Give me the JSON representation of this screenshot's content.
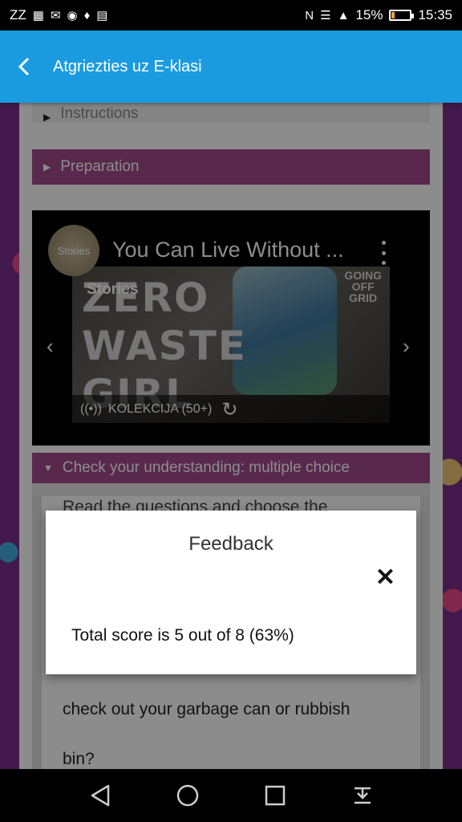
{
  "status_bar": {
    "left_text": "ZZ",
    "battery_percent": "15%",
    "time": "15:35",
    "battery_level": 0.15,
    "icons": [
      "sleep-icon",
      "image-icon",
      "mail-icon",
      "eye-icon",
      "bell-icon",
      "gift-icon",
      "nfc-icon",
      "wifi-icon",
      "signal-icon",
      "battery-icon"
    ]
  },
  "app_bar": {
    "title": "Atgriezties uz E-klasi",
    "background": "#1a9be0"
  },
  "sections": {
    "instructions": "Instructions",
    "preparation": "Preparation",
    "check": "Check your understanding: multiple choice"
  },
  "video": {
    "avatar_text": "Stories",
    "title": "You Can Live Without ...",
    "stories_tag": "Stories",
    "thumb_line1": "ZERO",
    "thumb_line2": "WASTE",
    "thumb_line3": "GIRL",
    "thumb_corner_line1": "GOING",
    "thumb_corner_line2": "OFF",
    "thumb_corner_line3": "GRID",
    "collection_label": "KOLEKCIJA (50+)"
  },
  "question": {
    "partial_top": "Read the questions and choose the",
    "line1": "check out your garbage can or rubbish",
    "line2": "bin?"
  },
  "feedback_modal": {
    "title": "Feedback",
    "score_text": "Total score is 5 out of 8 (63%)"
  },
  "colors": {
    "section_accent": "#a24b8d",
    "background": "#7a2e8c"
  }
}
